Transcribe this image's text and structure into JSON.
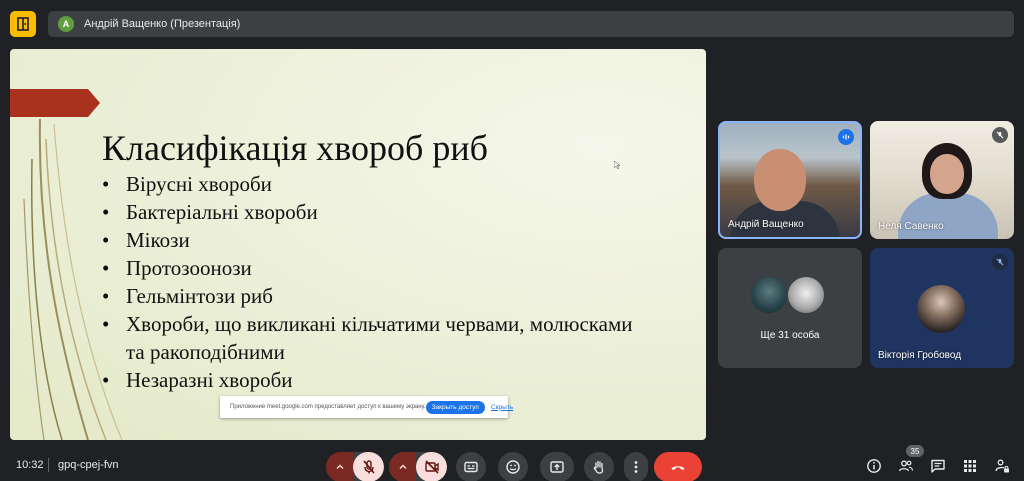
{
  "topbar": {
    "presenter_initial": "A",
    "presenter_title": "Андрій Ващенко (Презентація)"
  },
  "slide": {
    "title": "Класифікація хвороб риб",
    "bullets": [
      "Вірусні хвороби",
      "Бактеріальні хвороби",
      "Мікози",
      "Протозоонози",
      "Гельмінтози риб",
      "Хвороби, що викликані кільчатими червами, молюсками та ракоподібними",
      "Незаразні хвороби"
    ],
    "share_bar": {
      "message": "Приложение meet.google.com предоставляет доступ к вашему экрану.",
      "stop_label": "Закрыть доступ",
      "hide_label": "Скрыть"
    }
  },
  "participants": [
    {
      "name": "Андрій Ващенко",
      "speaking": true
    },
    {
      "name": "Неля Савенко",
      "muted": true
    },
    {
      "more_label": "Ще 31 особа"
    },
    {
      "name": "Вікторія Гробовод",
      "muted": true
    }
  ],
  "footer": {
    "time": "10:32",
    "meeting_code": "gpq-cpej-fvn",
    "people_count": "35"
  },
  "colors": {
    "background": "#202124",
    "surface": "#3c4043",
    "accent": "#8ab4f8",
    "hangup": "#ea4335",
    "slide_tag": "#a8321d",
    "share_stop": "#1a73e8"
  },
  "icons": {
    "logo": "meet-logo-icon",
    "mic": "mic-off-icon",
    "camera": "camera-off-icon",
    "captions": "captions-icon",
    "reactions": "emoji-icon",
    "present": "present-icon",
    "hand": "raise-hand-icon",
    "more": "more-vert-icon",
    "hangup": "call-end-icon",
    "info": "info-icon",
    "people": "people-icon",
    "chat": "chat-icon",
    "activities": "apps-icon",
    "host": "lock-person-icon"
  }
}
